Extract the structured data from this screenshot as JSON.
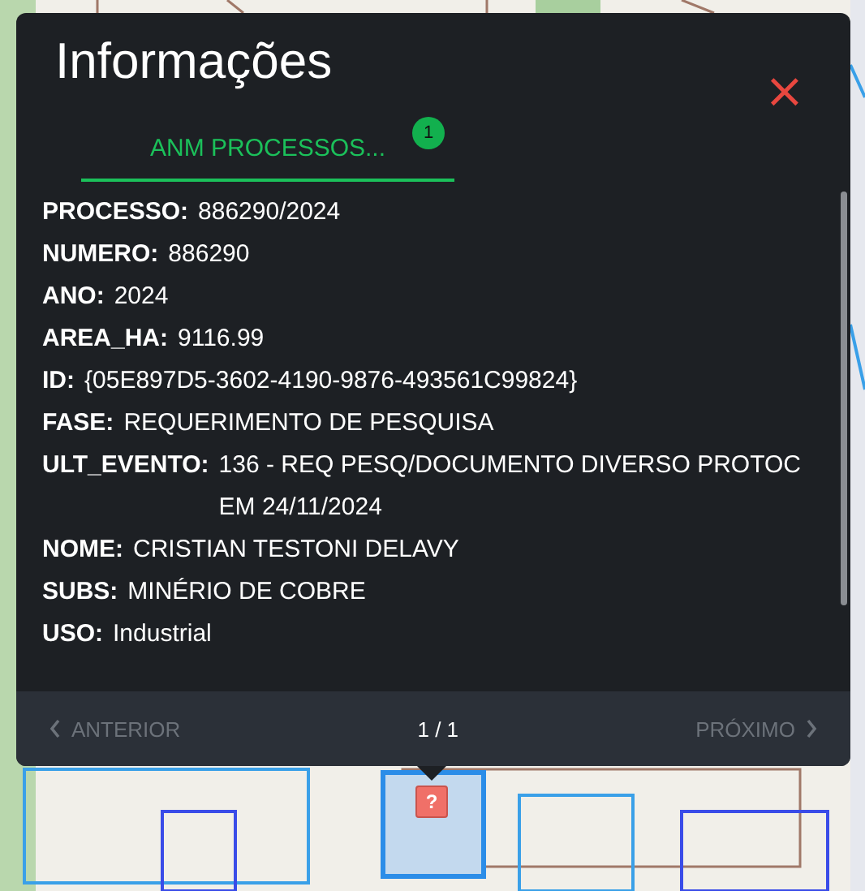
{
  "map_marker": {
    "symbol": "?"
  },
  "popup": {
    "title": "Informações",
    "close": "×",
    "tabs": [
      {
        "label": "ANM PROCESSOS...",
        "badge": "1",
        "selected": true
      }
    ],
    "fields": [
      {
        "label": "PROCESSO:",
        "value": "886290/2024"
      },
      {
        "label": "NUMERO:",
        "value": "886290"
      },
      {
        "label": "ANO:",
        "value": "2024"
      },
      {
        "label": "AREA_HA:",
        "value": "9116.99"
      },
      {
        "label": "ID:",
        "value": "{05E897D5-3602-4190-9876-493561C99824}"
      },
      {
        "label": "FASE:",
        "value": "REQUERIMENTO DE PESQUISA"
      },
      {
        "label": "ULT_EVENTO:",
        "value": "136 - REQ PESQ/DOCUMENTO DIVERSO PROTOC EM 24/11/2024"
      },
      {
        "label": "NOME:",
        "value": "CRISTIAN TESTONI DELAVY"
      },
      {
        "label": "SUBS:",
        "value": "MINÉRIO DE COBRE"
      },
      {
        "label": "USO:",
        "value": "Industrial"
      }
    ],
    "pager": {
      "previous": {
        "label": "ANTERIOR",
        "disabled": true
      },
      "count": "1 / 1",
      "next": {
        "label": "PRÓXIMO",
        "disabled": true
      }
    }
  }
}
